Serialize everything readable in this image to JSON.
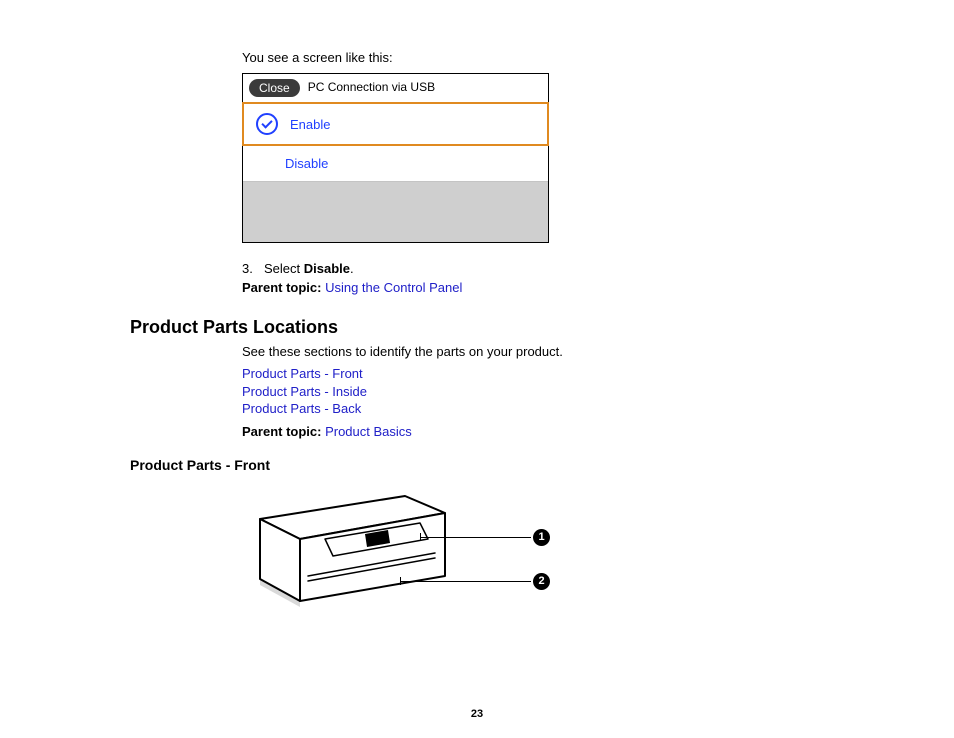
{
  "intro": "You see a screen like this:",
  "lcd": {
    "close": "Close",
    "title": "PC Connection via USB",
    "option_enable": "Enable",
    "option_disable": "Disable"
  },
  "step": {
    "number": "3.",
    "prefix": "Select ",
    "bold": "Disable",
    "suffix": "."
  },
  "parent1": {
    "label": "Parent topic: ",
    "link": "Using the Control Panel"
  },
  "section_heading": "Product Parts Locations",
  "section_intro": "See these sections to identify the parts on your product.",
  "links": {
    "front": "Product Parts - Front",
    "inside": "Product Parts - Inside",
    "back": "Product Parts - Back"
  },
  "parent2": {
    "label": "Parent topic: ",
    "link": "Product Basics"
  },
  "subsection_heading": "Product Parts - Front",
  "callouts": {
    "c1": "1",
    "c2": "2"
  },
  "page_number": "23"
}
